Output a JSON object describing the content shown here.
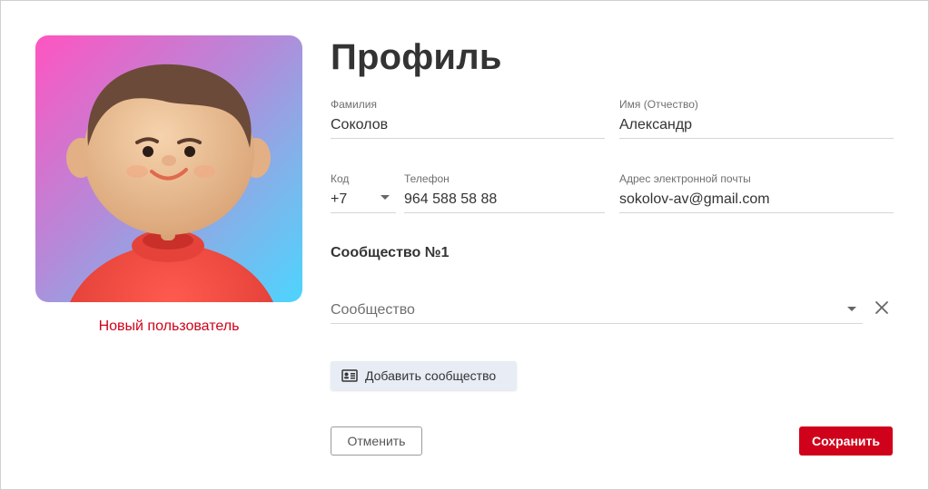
{
  "colors": {
    "accent": "#d0021b",
    "add_button_bg": "#e7ecf5",
    "avatar_gradient": [
      "#ff54c0",
      "#b48ad9",
      "#7bb7ec",
      "#4dd4ff"
    ]
  },
  "profile": {
    "title": "Профиль",
    "user_caption": "Новый пользователь"
  },
  "fields": {
    "last_name": {
      "label": "Фамилия",
      "value": "Соколов"
    },
    "first_name": {
      "label": "Имя (Отчество)",
      "value": "Александр"
    },
    "code": {
      "label": "Код",
      "value": "+7"
    },
    "phone": {
      "label": "Телефон",
      "value": "964 588 58 88"
    },
    "email": {
      "label": "Адрес электронной почты",
      "value": "sokolov-av@gmail.com"
    }
  },
  "community": {
    "section_title": "Сообщество №1",
    "select_placeholder": "Сообщество",
    "add_label": "Добавить сообщество"
  },
  "actions": {
    "cancel_label": "Отменить",
    "save_label": "Сохранить"
  },
  "icons": {
    "avatar": "cartoon-avatar-image",
    "code_dropdown": "chevron-down-icon",
    "community_dropdown": "chevron-down-icon",
    "clear": "close-icon",
    "add_community": "id-card-icon"
  }
}
